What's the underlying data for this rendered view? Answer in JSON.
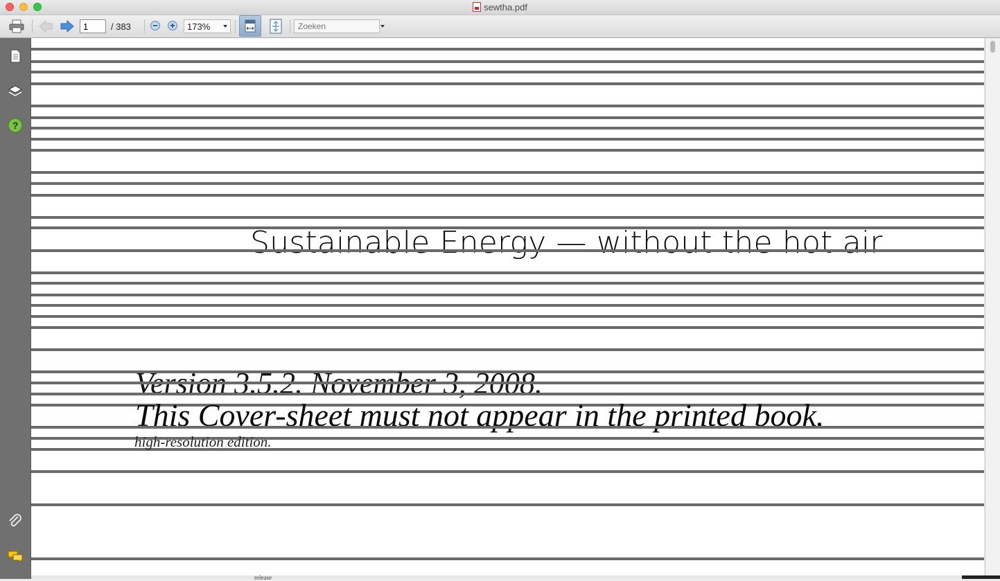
{
  "window": {
    "title": "sewtha.pdf",
    "file_icon": "pdf-file-icon"
  },
  "toolbar": {
    "page_current": "1",
    "page_total": "/ 383",
    "zoom_value": "173%",
    "search_placeholder": "Zoeken",
    "icons": [
      "print-icon",
      "previous-page-icon",
      "next-page-icon",
      "zoom-out-icon",
      "zoom-in-icon",
      "fit-width-icon",
      "fit-page-icon"
    ]
  },
  "sidebar": {
    "icons": [
      "pages-icon",
      "layers-icon",
      "help-icon",
      "attachment-icon",
      "comments-icon"
    ]
  },
  "document": {
    "title": "Sustainable Energy — without the hot air",
    "version_line": "Version 3.5.2. November 3, 2008.",
    "cover_note": "This Cover-sheet must not appear in the printed book.",
    "edition": "high-resolution edition.",
    "next_page_peek": "release"
  },
  "colors": {
    "sidebar": "#707070",
    "rule_lines": "#6a6a6a",
    "active_button": "#9fb8d6"
  }
}
